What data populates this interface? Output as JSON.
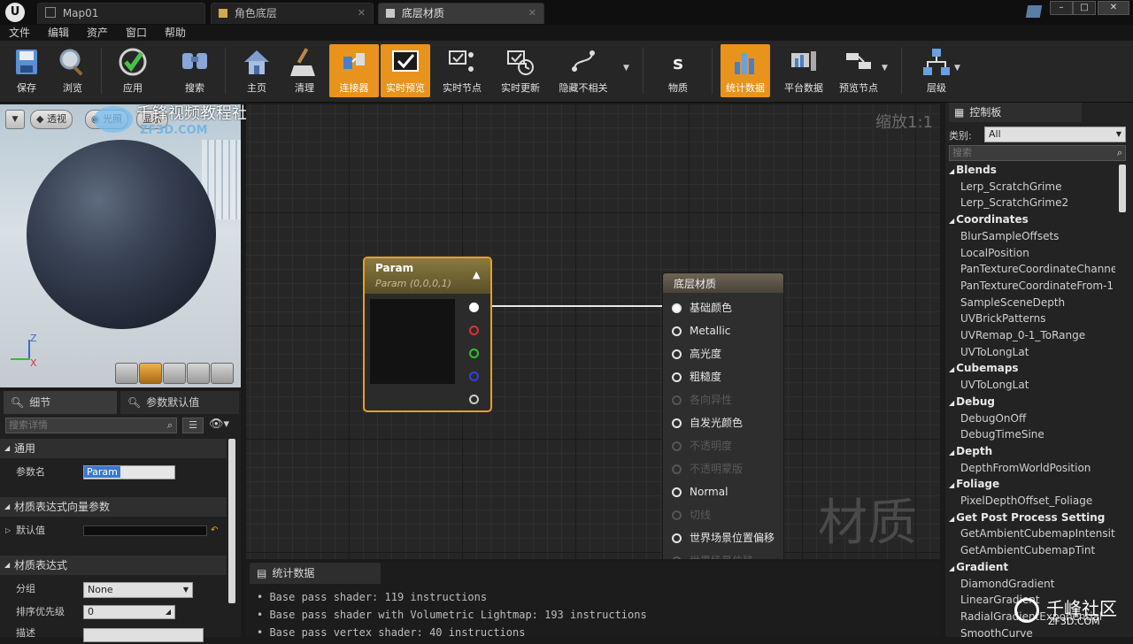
{
  "tabs": [
    {
      "label": "Map01"
    },
    {
      "label": "角色底层"
    },
    {
      "label": "底层材质"
    }
  ],
  "menu": [
    "文件",
    "编辑",
    "资产",
    "窗口",
    "帮助"
  ],
  "toolbar": [
    {
      "label": "保存",
      "icon": "save-icon"
    },
    {
      "label": "浏览",
      "icon": "browse-icon"
    },
    {
      "label": "应用",
      "icon": "apply-icon"
    },
    {
      "label": "搜索",
      "icon": "search-icon"
    },
    {
      "label": "主页",
      "icon": "home-icon"
    },
    {
      "label": "清理",
      "icon": "clean-icon"
    },
    {
      "label": "连接器",
      "icon": "connector-icon",
      "active": true
    },
    {
      "label": "实时预览",
      "icon": "live-preview-icon",
      "active": true
    },
    {
      "label": "实时节点",
      "icon": "live-nodes-icon"
    },
    {
      "label": "实时更新",
      "icon": "live-update-icon"
    },
    {
      "label": "隐藏不相关",
      "icon": "hide-unrelated-icon"
    },
    {
      "label": "物质",
      "icon": "substance-icon"
    },
    {
      "label": "统计数据",
      "icon": "stats-icon",
      "active": true
    },
    {
      "label": "平台数据",
      "icon": "platform-stats-icon"
    },
    {
      "label": "预览节点",
      "icon": "preview-node-icon"
    },
    {
      "label": "层级",
      "icon": "hierarchy-icon"
    }
  ],
  "viewport": {
    "perspective": "透视",
    "lit": "光照",
    "show": "显示",
    "axis_z": "Z",
    "axis_x": "X"
  },
  "watermark": {
    "text": "千锋视频教程社区",
    "sub": "ZF3D.COM"
  },
  "details": {
    "tab_details": "细节",
    "tab_params": "参数默认值",
    "search_placeholder": "搜索详情",
    "section_general": "通用",
    "param_name_label": "参数名",
    "param_name_value": "Param",
    "section_vector": "材质表达式向量参数",
    "default_label": "默认值",
    "section_expr": "材质表达式",
    "group_label": "分组",
    "group_value": "None",
    "priority_label": "排序优先级",
    "priority_value": "0",
    "desc_label": "描述"
  },
  "graph": {
    "zoom": "缩放1:1",
    "watermark": "材质",
    "param_title": "Param",
    "param_sub": "Param (0,0,0,1)",
    "main_title": "底层材质",
    "inputs": [
      {
        "label": "基础颜色",
        "enabled": true
      },
      {
        "label": "Metallic",
        "enabled": true
      },
      {
        "label": "高光度",
        "enabled": true
      },
      {
        "label": "粗糙度",
        "enabled": true
      },
      {
        "label": "各向异性",
        "enabled": false
      },
      {
        "label": "自发光颜色",
        "enabled": true
      },
      {
        "label": "不透明度",
        "enabled": false
      },
      {
        "label": "不透明蒙版",
        "enabled": false
      },
      {
        "label": "Normal",
        "enabled": true
      },
      {
        "label": "切线",
        "enabled": false
      },
      {
        "label": "世界场景位置偏移",
        "enabled": true
      },
      {
        "label": "世界场景位移",
        "enabled": false
      }
    ]
  },
  "stats": {
    "tab": "统计数据",
    "lines": [
      "Base pass shader: 119 instructions",
      "Base pass shader with Volumetric Lightmap: 193 instructions",
      "Base pass vertex shader: 40 instructions"
    ]
  },
  "palette": {
    "title": "控制板",
    "category_label": "类别:",
    "category_value": "All",
    "search_placeholder": "搜索",
    "entries": [
      {
        "t": "cat",
        "label": "Blends"
      },
      {
        "t": "item",
        "label": "Lerp_ScratchGrime"
      },
      {
        "t": "item",
        "label": "Lerp_ScratchGrime2"
      },
      {
        "t": "cat",
        "label": "Coordinates"
      },
      {
        "t": "item",
        "label": "BlurSampleOffsets"
      },
      {
        "t": "item",
        "label": "LocalPosition"
      },
      {
        "t": "item",
        "label": "PanTextureCoordinateChanne"
      },
      {
        "t": "item",
        "label": "PanTextureCoordinateFrom-1"
      },
      {
        "t": "item",
        "label": "SampleSceneDepth"
      },
      {
        "t": "item",
        "label": "UVBrickPatterns"
      },
      {
        "t": "item",
        "label": "UVRemap_0-1_ToRange"
      },
      {
        "t": "item",
        "label": "UVToLongLat"
      },
      {
        "t": "cat",
        "label": "Cubemaps"
      },
      {
        "t": "item",
        "label": "UVToLongLat"
      },
      {
        "t": "cat",
        "label": "Debug"
      },
      {
        "t": "item",
        "label": "DebugOnOff"
      },
      {
        "t": "item",
        "label": "DebugTimeSine"
      },
      {
        "t": "cat",
        "label": "Depth"
      },
      {
        "t": "item",
        "label": "DepthFromWorldPosition"
      },
      {
        "t": "cat",
        "label": "Foliage"
      },
      {
        "t": "item",
        "label": "PixelDepthOffset_Foliage"
      },
      {
        "t": "cat",
        "label": "Get Post Process Setting"
      },
      {
        "t": "item",
        "label": "GetAmbientCubemapIntensity"
      },
      {
        "t": "item",
        "label": "GetAmbientCubemapTint"
      },
      {
        "t": "cat",
        "label": "Gradient"
      },
      {
        "t": "item",
        "label": "DiamondGradient"
      },
      {
        "t": "item",
        "label": "LinearGradient"
      },
      {
        "t": "item",
        "label": "RadialGradientExponential"
      },
      {
        "t": "item",
        "label": "SmoothCurve"
      }
    ]
  },
  "corner_watermark": {
    "text": "千峰社区",
    "sub": "ZF3D.COM"
  },
  "colors": {
    "accent": "#e8931c",
    "node_border": "#e8a020"
  }
}
